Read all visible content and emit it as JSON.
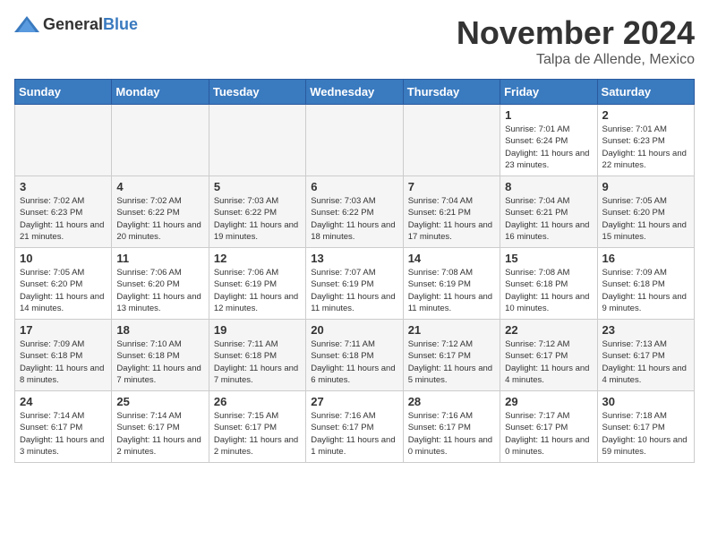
{
  "logo": {
    "general": "General",
    "blue": "Blue"
  },
  "title": {
    "month": "November 2024",
    "location": "Talpa de Allende, Mexico"
  },
  "weekdays": [
    "Sunday",
    "Monday",
    "Tuesday",
    "Wednesday",
    "Thursday",
    "Friday",
    "Saturday"
  ],
  "weeks": [
    [
      {
        "day": "",
        "info": "",
        "empty": true
      },
      {
        "day": "",
        "info": "",
        "empty": true
      },
      {
        "day": "",
        "info": "",
        "empty": true
      },
      {
        "day": "",
        "info": "",
        "empty": true
      },
      {
        "day": "",
        "info": "",
        "empty": true
      },
      {
        "day": "1",
        "info": "Sunrise: 7:01 AM\nSunset: 6:24 PM\nDaylight: 11 hours and 23 minutes.",
        "empty": false
      },
      {
        "day": "2",
        "info": "Sunrise: 7:01 AM\nSunset: 6:23 PM\nDaylight: 11 hours and 22 minutes.",
        "empty": false
      }
    ],
    [
      {
        "day": "3",
        "info": "Sunrise: 7:02 AM\nSunset: 6:23 PM\nDaylight: 11 hours and 21 minutes.",
        "empty": false
      },
      {
        "day": "4",
        "info": "Sunrise: 7:02 AM\nSunset: 6:22 PM\nDaylight: 11 hours and 20 minutes.",
        "empty": false
      },
      {
        "day": "5",
        "info": "Sunrise: 7:03 AM\nSunset: 6:22 PM\nDaylight: 11 hours and 19 minutes.",
        "empty": false
      },
      {
        "day": "6",
        "info": "Sunrise: 7:03 AM\nSunset: 6:22 PM\nDaylight: 11 hours and 18 minutes.",
        "empty": false
      },
      {
        "day": "7",
        "info": "Sunrise: 7:04 AM\nSunset: 6:21 PM\nDaylight: 11 hours and 17 minutes.",
        "empty": false
      },
      {
        "day": "8",
        "info": "Sunrise: 7:04 AM\nSunset: 6:21 PM\nDaylight: 11 hours and 16 minutes.",
        "empty": false
      },
      {
        "day": "9",
        "info": "Sunrise: 7:05 AM\nSunset: 6:20 PM\nDaylight: 11 hours and 15 minutes.",
        "empty": false
      }
    ],
    [
      {
        "day": "10",
        "info": "Sunrise: 7:05 AM\nSunset: 6:20 PM\nDaylight: 11 hours and 14 minutes.",
        "empty": false
      },
      {
        "day": "11",
        "info": "Sunrise: 7:06 AM\nSunset: 6:20 PM\nDaylight: 11 hours and 13 minutes.",
        "empty": false
      },
      {
        "day": "12",
        "info": "Sunrise: 7:06 AM\nSunset: 6:19 PM\nDaylight: 11 hours and 12 minutes.",
        "empty": false
      },
      {
        "day": "13",
        "info": "Sunrise: 7:07 AM\nSunset: 6:19 PM\nDaylight: 11 hours and 11 minutes.",
        "empty": false
      },
      {
        "day": "14",
        "info": "Sunrise: 7:08 AM\nSunset: 6:19 PM\nDaylight: 11 hours and 11 minutes.",
        "empty": false
      },
      {
        "day": "15",
        "info": "Sunrise: 7:08 AM\nSunset: 6:18 PM\nDaylight: 11 hours and 10 minutes.",
        "empty": false
      },
      {
        "day": "16",
        "info": "Sunrise: 7:09 AM\nSunset: 6:18 PM\nDaylight: 11 hours and 9 minutes.",
        "empty": false
      }
    ],
    [
      {
        "day": "17",
        "info": "Sunrise: 7:09 AM\nSunset: 6:18 PM\nDaylight: 11 hours and 8 minutes.",
        "empty": false
      },
      {
        "day": "18",
        "info": "Sunrise: 7:10 AM\nSunset: 6:18 PM\nDaylight: 11 hours and 7 minutes.",
        "empty": false
      },
      {
        "day": "19",
        "info": "Sunrise: 7:11 AM\nSunset: 6:18 PM\nDaylight: 11 hours and 7 minutes.",
        "empty": false
      },
      {
        "day": "20",
        "info": "Sunrise: 7:11 AM\nSunset: 6:18 PM\nDaylight: 11 hours and 6 minutes.",
        "empty": false
      },
      {
        "day": "21",
        "info": "Sunrise: 7:12 AM\nSunset: 6:17 PM\nDaylight: 11 hours and 5 minutes.",
        "empty": false
      },
      {
        "day": "22",
        "info": "Sunrise: 7:12 AM\nSunset: 6:17 PM\nDaylight: 11 hours and 4 minutes.",
        "empty": false
      },
      {
        "day": "23",
        "info": "Sunrise: 7:13 AM\nSunset: 6:17 PM\nDaylight: 11 hours and 4 minutes.",
        "empty": false
      }
    ],
    [
      {
        "day": "24",
        "info": "Sunrise: 7:14 AM\nSunset: 6:17 PM\nDaylight: 11 hours and 3 minutes.",
        "empty": false
      },
      {
        "day": "25",
        "info": "Sunrise: 7:14 AM\nSunset: 6:17 PM\nDaylight: 11 hours and 2 minutes.",
        "empty": false
      },
      {
        "day": "26",
        "info": "Sunrise: 7:15 AM\nSunset: 6:17 PM\nDaylight: 11 hours and 2 minutes.",
        "empty": false
      },
      {
        "day": "27",
        "info": "Sunrise: 7:16 AM\nSunset: 6:17 PM\nDaylight: 11 hours and 1 minute.",
        "empty": false
      },
      {
        "day": "28",
        "info": "Sunrise: 7:16 AM\nSunset: 6:17 PM\nDaylight: 11 hours and 0 minutes.",
        "empty": false
      },
      {
        "day": "29",
        "info": "Sunrise: 7:17 AM\nSunset: 6:17 PM\nDaylight: 11 hours and 0 minutes.",
        "empty": false
      },
      {
        "day": "30",
        "info": "Sunrise: 7:18 AM\nSunset: 6:17 PM\nDaylight: 10 hours and 59 minutes.",
        "empty": false
      }
    ]
  ]
}
